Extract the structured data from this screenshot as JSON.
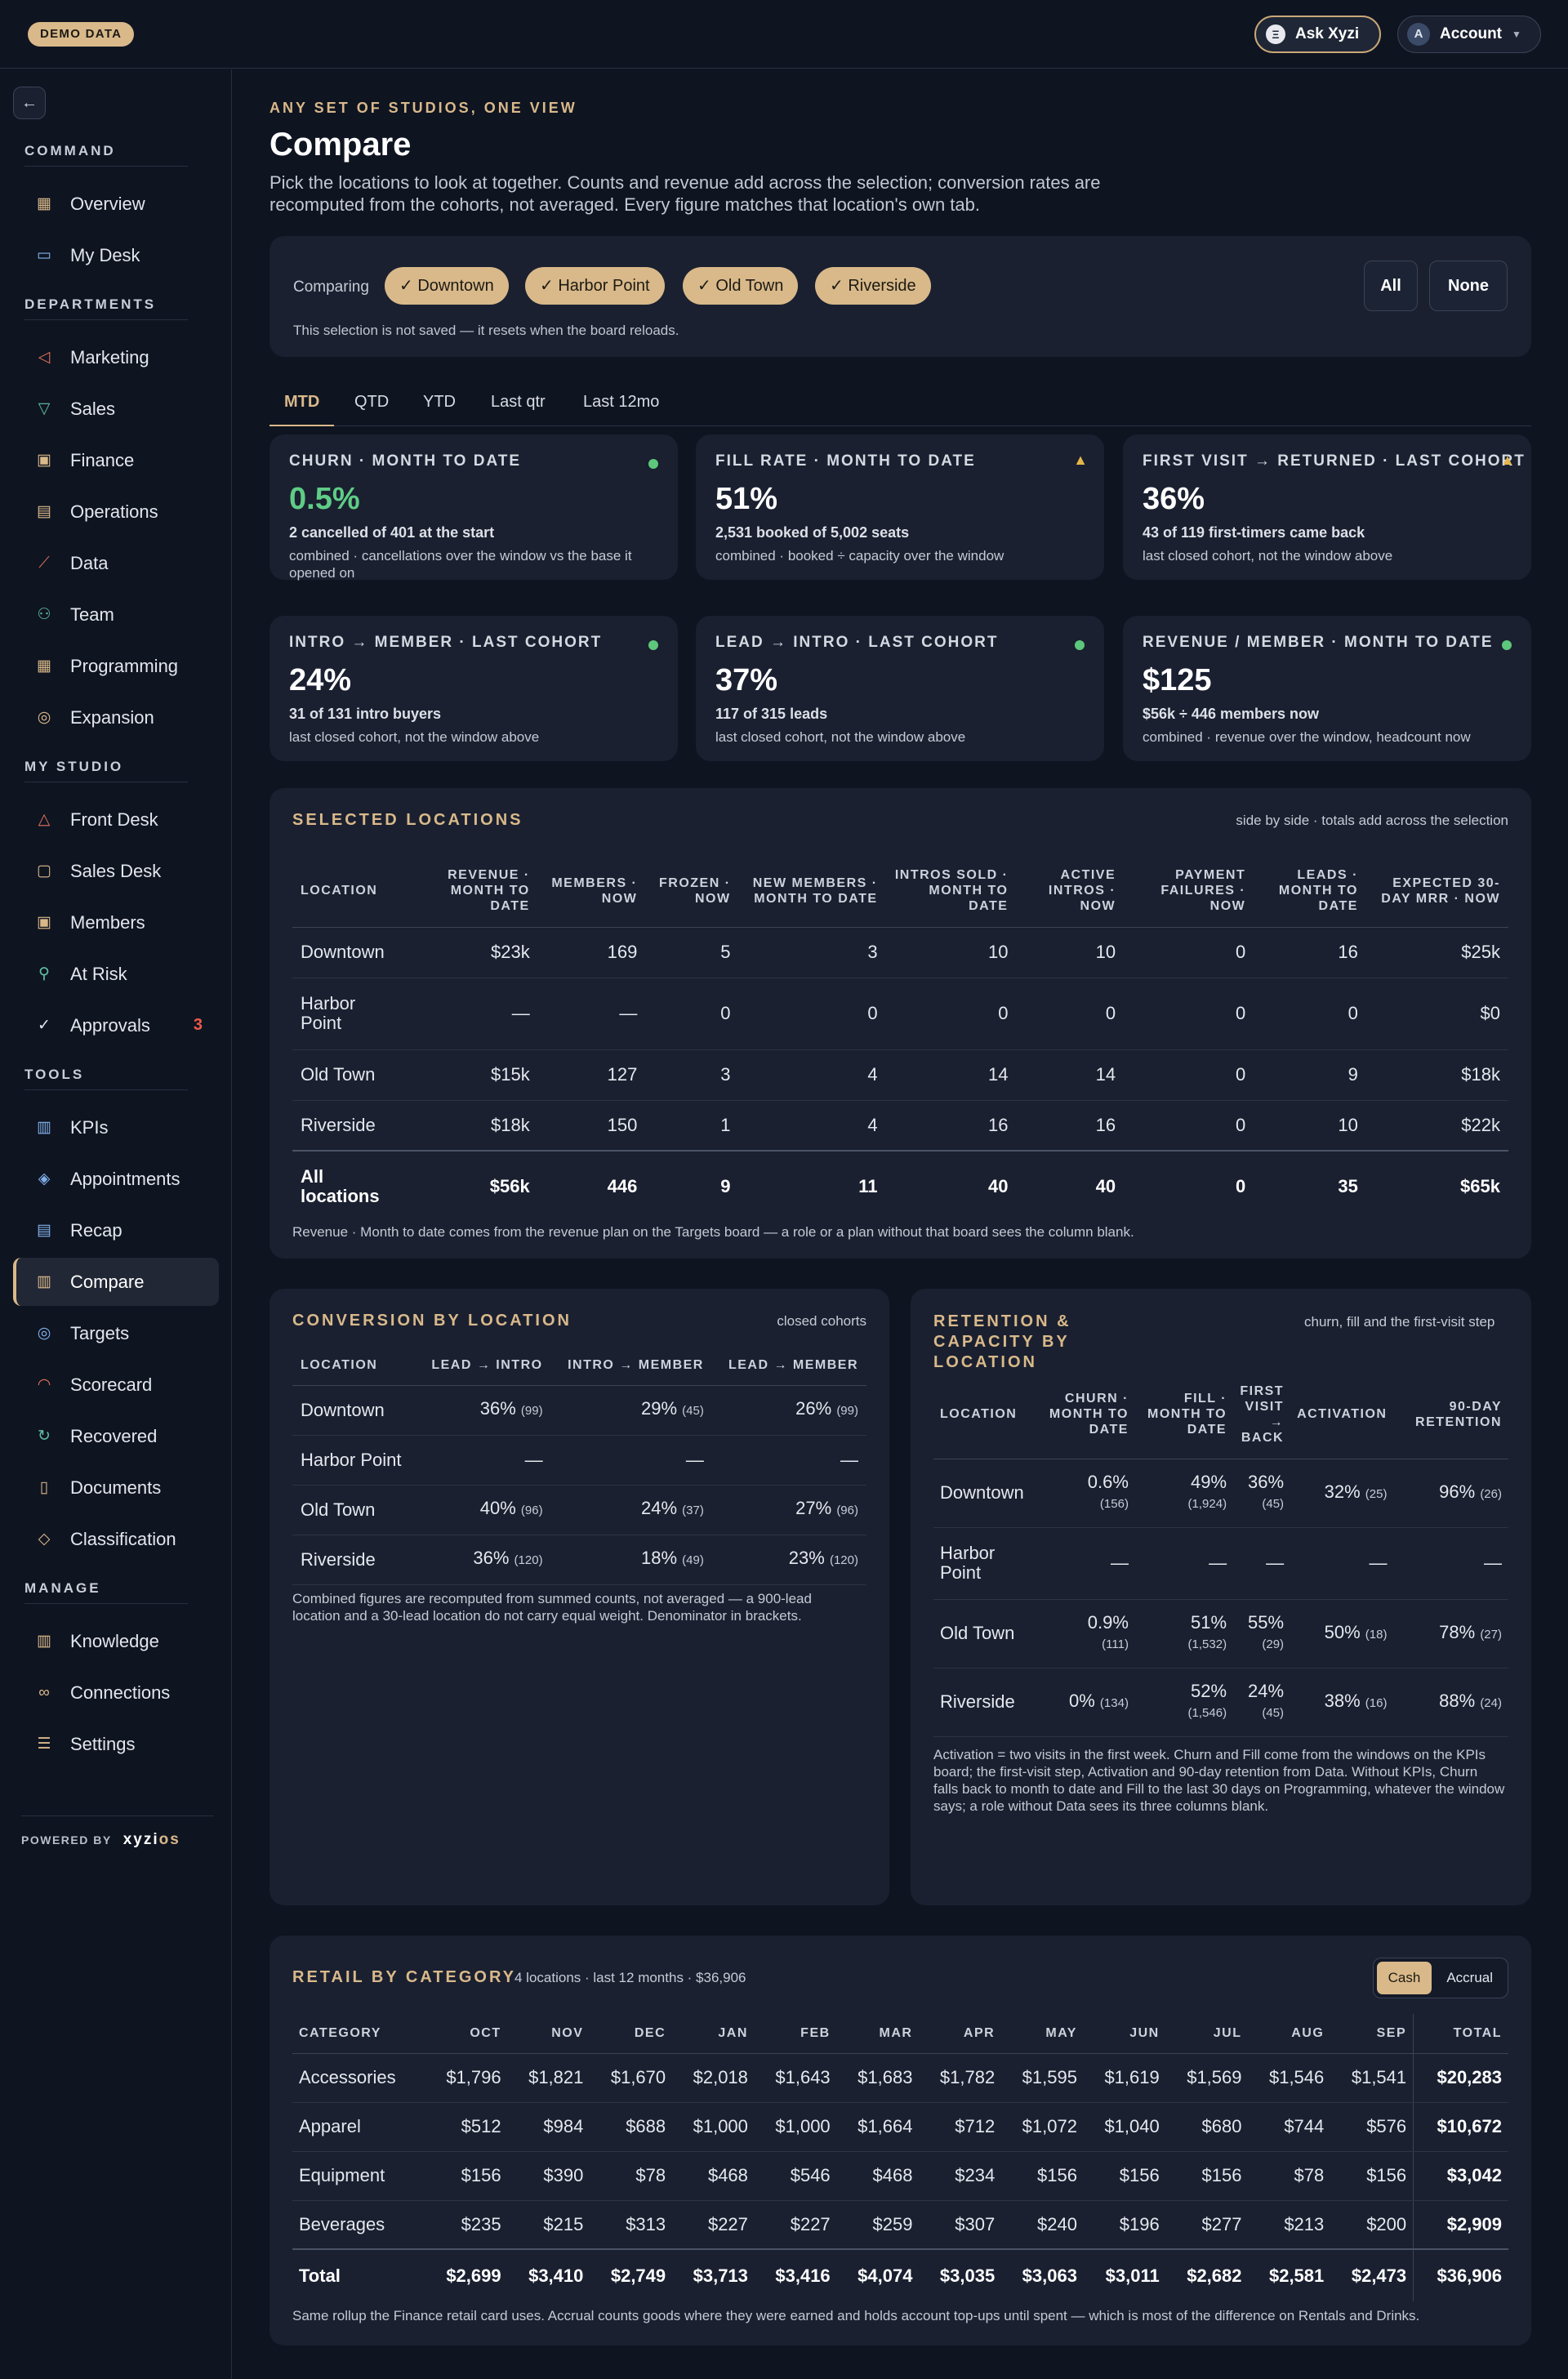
{
  "topbar": {
    "demo": "DEMO DATA",
    "ask": "Ask Xyzi",
    "account": "Account",
    "avatar_letter": "A"
  },
  "sidebar": {
    "sections": {
      "command": "COMMAND",
      "departments": "DEPARTMENTS",
      "my_studio": "MY STUDIO",
      "tools": "TOOLS",
      "manage": "MANAGE"
    },
    "items": {
      "overview": "Overview",
      "my_desk": "My Desk",
      "marketing": "Marketing",
      "sales": "Sales",
      "finance": "Finance",
      "operations": "Operations",
      "data": "Data",
      "team": "Team",
      "programming": "Programming",
      "expansion": "Expansion",
      "front_desk": "Front Desk",
      "sales_desk": "Sales Desk",
      "members": "Members",
      "at_risk": "At Risk",
      "approvals": "Approvals",
      "approvals_badge": "3",
      "kpis": "KPIs",
      "appointments": "Appointments",
      "recap": "Recap",
      "compare": "Compare",
      "targets": "Targets",
      "scorecard": "Scorecard",
      "recovered": "Recovered",
      "documents": "Documents",
      "classification": "Classification",
      "knowledge": "Knowledge",
      "connections": "Connections",
      "settings": "Settings"
    },
    "powered_by": "POWERED BY",
    "brand_a": "xyzi",
    "brand_b": "os"
  },
  "page": {
    "eyebrow": "ANY SET OF STUDIOS, ONE VIEW",
    "title": "Compare",
    "description": "Pick the locations to look at together. Counts and revenue add across the selection; conversion rates are recomputed from the cohorts, not averaged. Every figure matches that location's own tab."
  },
  "selector": {
    "label": "Comparing",
    "chips": [
      "✓ Downtown",
      "✓ Harbor Point",
      "✓ Old Town",
      "✓ Riverside"
    ],
    "all": "All",
    "none": "None",
    "note": "This selection is not saved — it resets when the board reloads."
  },
  "tabs": [
    "MTD",
    "QTD",
    "YTD",
    "Last qtr",
    "Last 12mo"
  ],
  "kpis": [
    {
      "title": "CHURN · MONTH TO DATE",
      "value": "0.5%",
      "sub": "2 cancelled of 401 at the start",
      "note": "combined · cancellations over the window vs the base it opened on",
      "status": "ok"
    },
    {
      "title": "FILL RATE · MONTH TO DATE",
      "value": "51%",
      "sub": "2,531 booked of 5,002 seats",
      "note": "combined · booked ÷ capacity over the window",
      "status": "warn"
    },
    {
      "title": "FIRST VISIT → RETURNED · LAST COHORT",
      "value": "36%",
      "sub": "43 of 119 first-timers came back",
      "note": "last closed cohort, not the window above",
      "status": "warn"
    },
    {
      "title": "INTRO → MEMBER · LAST COHORT",
      "value": "24%",
      "sub": "31 of 131 intro buyers",
      "note": "last closed cohort, not the window above",
      "status": "ok"
    },
    {
      "title": "LEAD → INTRO · LAST COHORT",
      "value": "37%",
      "sub": "117 of 315 leads",
      "note": "last closed cohort, not the window above",
      "status": "ok"
    },
    {
      "title": "REVENUE / MEMBER · MONTH TO DATE",
      "value": "$125",
      "sub": "$56k ÷ 446 members now",
      "note": "combined · revenue over the window, headcount now",
      "status": "ok"
    }
  ],
  "colors": {
    "accent": "#d9b98a",
    "ok": "#5dc87b",
    "warn": "#e6b64a",
    "danger": "#ef5a4a",
    "background": "#0f1421",
    "card": "#1a2030"
  },
  "selected": {
    "title": "SELECTED LOCATIONS",
    "subtitle": "side by side · totals add across the selection",
    "headers": [
      "LOCATION",
      "REVENUE · MONTH TO DATE",
      "MEMBERS · NOW",
      "FROZEN · NOW",
      "NEW MEMBERS · MONTH TO DATE",
      "INTROS SOLD · MONTH TO DATE",
      "ACTIVE INTROS · NOW",
      "PAYMENT FAILURES · NOW",
      "LEADS · MONTH TO DATE",
      "EXPECTED 30-DAY MRR · NOW"
    ],
    "rows": [
      [
        "Downtown",
        "$23k",
        "169",
        "5",
        "3",
        "10",
        "10",
        "0",
        "16",
        "$25k"
      ],
      [
        "Harbor Point",
        "—",
        "—",
        "0",
        "0",
        "0",
        "0",
        "0",
        "0",
        "$0"
      ],
      [
        "Old Town",
        "$15k",
        "127",
        "3",
        "4",
        "14",
        "14",
        "0",
        "9",
        "$18k"
      ],
      [
        "Riverside",
        "$18k",
        "150",
        "1",
        "4",
        "16",
        "16",
        "0",
        "10",
        "$22k"
      ]
    ],
    "total": [
      "All locations",
      "$56k",
      "446",
      "9",
      "11",
      "40",
      "40",
      "0",
      "35",
      "$65k"
    ],
    "footnote": "Revenue · Month to date comes from the revenue plan on the Targets board — a role or a plan without that board sees the column blank."
  },
  "conversion": {
    "title": "CONVERSION BY LOCATION",
    "subtitle": "closed cohorts",
    "headers": [
      "LOCATION",
      "LEAD → INTRO",
      "INTRO → MEMBER",
      "LEAD → MEMBER"
    ],
    "rows": [
      [
        {
          "v": "Downtown"
        },
        {
          "v": "36%",
          "n": "(99)"
        },
        {
          "v": "29%",
          "n": "(45)"
        },
        {
          "v": "26%",
          "n": "(99)"
        }
      ],
      [
        {
          "v": "Harbor Point"
        },
        {
          "v": "—"
        },
        {
          "v": "—"
        },
        {
          "v": "—"
        }
      ],
      [
        {
          "v": "Old Town"
        },
        {
          "v": "40%",
          "n": "(96)"
        },
        {
          "v": "24%",
          "n": "(37)"
        },
        {
          "v": "27%",
          "n": "(96)"
        }
      ],
      [
        {
          "v": "Riverside"
        },
        {
          "v": "36%",
          "n": "(120)"
        },
        {
          "v": "18%",
          "n": "(49)"
        },
        {
          "v": "23%",
          "n": "(120)"
        }
      ]
    ],
    "footnote": "Combined figures are recomputed from summed counts, not averaged — a 900-lead location and a 30-lead location do not carry equal weight. Denominator in brackets."
  },
  "retention": {
    "title": "RETENTION & CAPACITY BY LOCATION",
    "subtitle": "churn, fill and the first-visit step",
    "headers": [
      "LOCATION",
      "CHURN · MONTH TO DATE",
      "FILL · MONTH TO DATE",
      "FIRST VISIT → BACK",
      "ACTIVATION",
      "90-DAY RETENTION"
    ],
    "rows": [
      [
        {
          "v": "Downtown"
        },
        {
          "v": "0.6%",
          "n": "(156)",
          "br": true
        },
        {
          "v": "49%",
          "n": "(1,924)",
          "br": true
        },
        {
          "v": "36%",
          "n": "(45)",
          "br": true
        },
        {
          "v": "32%",
          "n": "(25)"
        },
        {
          "v": "96%",
          "n": "(26)"
        }
      ],
      [
        {
          "v": "Harbor Point"
        },
        {
          "v": "—"
        },
        {
          "v": "—"
        },
        {
          "v": "—"
        },
        {
          "v": "—"
        },
        {
          "v": "—"
        }
      ],
      [
        {
          "v": "Old Town"
        },
        {
          "v": "0.9%",
          "n": "(111)",
          "br": true
        },
        {
          "v": "51%",
          "n": "(1,532)",
          "br": true
        },
        {
          "v": "55%",
          "n": "(29)",
          "br": true
        },
        {
          "v": "50%",
          "n": "(18)"
        },
        {
          "v": "78%",
          "n": "(27)"
        }
      ],
      [
        {
          "v": "Riverside"
        },
        {
          "v": "0%",
          "n": "(134)"
        },
        {
          "v": "52%",
          "n": "(1,546)",
          "br": true
        },
        {
          "v": "24%",
          "n": "(45)",
          "br": true
        },
        {
          "v": "38%",
          "n": "(16)"
        },
        {
          "v": "88%",
          "n": "(24)"
        }
      ]
    ],
    "footnote": "Activation = two visits in the first week. Churn and Fill come from the windows on the KPIs board; the first-visit step, Activation and 90-day retention from Data. Without KPIs, Churn falls back to month to date and Fill to the last 30 days on Programming, whatever the window says; a role without Data sees its three columns blank."
  },
  "retail": {
    "title": "RETAIL BY CATEGORY",
    "meta": "4 locations · last 12 months · $36,906",
    "toggle": [
      "Cash",
      "Accrual"
    ],
    "headers": [
      "CATEGORY",
      "OCT",
      "NOV",
      "DEC",
      "JAN",
      "FEB",
      "MAR",
      "APR",
      "MAY",
      "JUN",
      "JUL",
      "AUG",
      "SEP",
      "TOTAL"
    ],
    "rows": [
      [
        "Accessories",
        "$1,796",
        "$1,821",
        "$1,670",
        "$2,018",
        "$1,643",
        "$1,683",
        "$1,782",
        "$1,595",
        "$1,619",
        "$1,569",
        "$1,546",
        "$1,541",
        "$20,283"
      ],
      [
        "Apparel",
        "$512",
        "$984",
        "$688",
        "$1,000",
        "$1,000",
        "$1,664",
        "$712",
        "$1,072",
        "$1,040",
        "$680",
        "$744",
        "$576",
        "$10,672"
      ],
      [
        "Equipment",
        "$156",
        "$390",
        "$78",
        "$468",
        "$546",
        "$468",
        "$234",
        "$156",
        "$156",
        "$156",
        "$78",
        "$156",
        "$3,042"
      ],
      [
        "Beverages",
        "$235",
        "$215",
        "$313",
        "$227",
        "$227",
        "$259",
        "$307",
        "$240",
        "$196",
        "$277",
        "$213",
        "$200",
        "$2,909"
      ]
    ],
    "total": [
      "Total",
      "$2,699",
      "$3,410",
      "$2,749",
      "$3,713",
      "$3,416",
      "$4,074",
      "$3,035",
      "$3,063",
      "$3,011",
      "$2,682",
      "$2,581",
      "$2,473",
      "$36,906"
    ],
    "footnote": "Same rollup the Finance retail card uses. Accrual counts goods where they were earned and holds account top-ups until spent — which is most of the difference on Rentals and Drinks."
  }
}
